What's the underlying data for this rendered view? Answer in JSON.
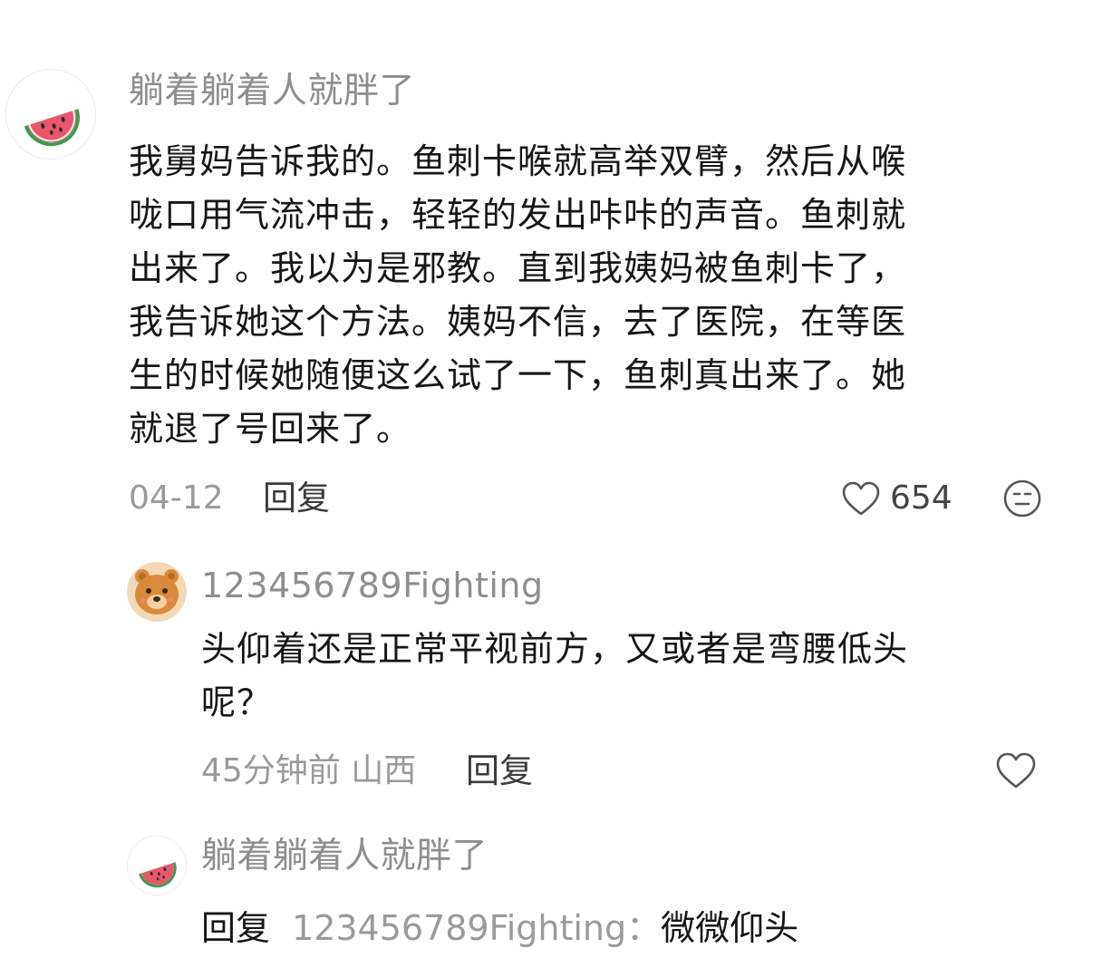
{
  "comments": [
    {
      "username": "躺着躺着人就胖了",
      "avatar_icon": "watermelon-icon",
      "text_lines": [
        "我舅妈告诉我的。鱼刺卡喉就高举双臂，然后从喉",
        "咙口用气流冲击，轻轻的发出咔咔的声音。鱼刺就",
        "出来了。我以为是邪教。直到我姨妈被鱼刺卡了，",
        "我告诉她这个方法。姨妈不信，去了医院，在等医",
        "生的时候她随便这么试了一下，鱼刺真出来了。她",
        "就退了号回来了。"
      ],
      "date": "04-12",
      "reply_label": "回复",
      "like_count": "654",
      "like_icon": "heart-outline-icon",
      "extra_icon": "emoji-face-icon"
    },
    {
      "username": "123456789Fighting",
      "avatar_icon": "bear-icon",
      "text_lines": [
        "头仰着还是正常平视前方，又或者是弯腰低头",
        "呢？"
      ],
      "time_location": "45分钟前 山西",
      "reply_label": "回复",
      "like_icon": "heart-outline-icon"
    },
    {
      "username": "躺着躺着人就胖了",
      "avatar_icon": "watermelon-icon",
      "reply_prefix": "回复",
      "reply_target": "123456789Fighting：",
      "reply_text": "微微仰头"
    }
  ],
  "colors": {
    "username": "#8e8e8e",
    "body_text": "#161616",
    "meta": "#9a9a9a",
    "watermelon_red": "#e8576a",
    "watermelon_green": "#3f9a4c",
    "bear_orange": "#d98a3a"
  }
}
